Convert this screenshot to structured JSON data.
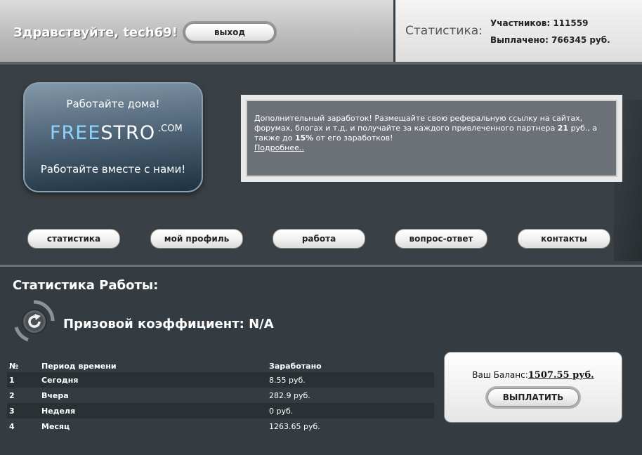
{
  "header": {
    "greeting": "Здравствуйте, tech69!",
    "logout_label": "выход",
    "stats_title": "Статистика:",
    "participants": "Участников: 111559",
    "paid": "Выплачено: 766345 руб."
  },
  "logo": {
    "tagline_top": "Работайте дома!",
    "brand_free": "FREE",
    "brand_stro": "STRO",
    "brand_domain": ".COM",
    "tagline_bottom": "Работайте вместе с нами!"
  },
  "info": {
    "part1": "Дополнительный заработок! Размещайте свою реферальную ссылку на сайтах, форумах, блогах и т.д. и получайте за каждого привлеченного партнера ",
    "amount": "21",
    "part2": " руб., а также до ",
    "percent": "15%",
    "part3": " от его заработков!",
    "more_link": "Подробнее.."
  },
  "nav": [
    {
      "label": "статистика"
    },
    {
      "label": "мой профиль"
    },
    {
      "label": "работа"
    },
    {
      "label": "вопрос-ответ"
    },
    {
      "label": "контакты"
    }
  ],
  "content": {
    "title": "Статистика Работы:",
    "coefficient": "Призовой коэффициент: N/A",
    "table": {
      "headers": [
        "№",
        "Период времени",
        "Заработано"
      ],
      "rows": [
        [
          "1",
          "Сегодня",
          "8.55 руб."
        ],
        [
          "2",
          "Вчера",
          "282.9 руб."
        ],
        [
          "3",
          "Неделя",
          "0 руб."
        ],
        [
          "4",
          "Месяц",
          "1263.65 руб."
        ]
      ]
    },
    "balance": {
      "label": "Ваш Баланс:",
      "amount": "1507.55 руб.",
      "payout_label": "ВЫПЛАТИТЬ"
    }
  },
  "colors": {
    "background": "#3a4146",
    "content_bg": "#353c41",
    "info_bg": "#6b7176",
    "logo_accent": "#8ed3ff"
  }
}
